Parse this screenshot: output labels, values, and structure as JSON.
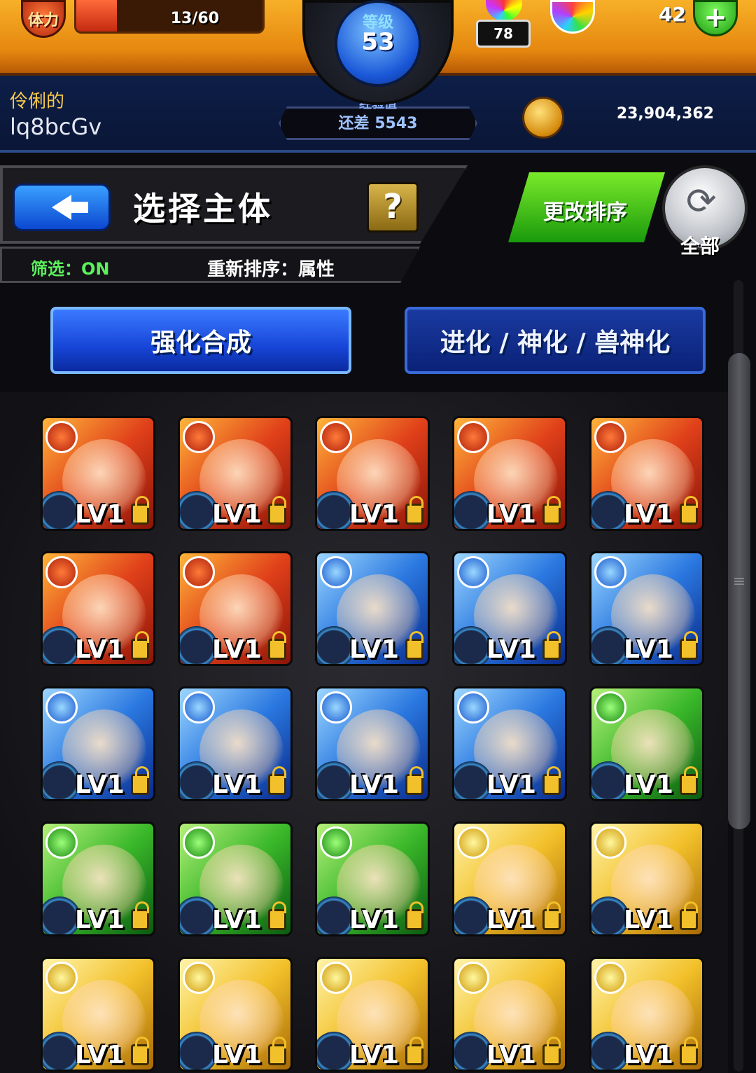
{
  "header": {
    "stamina_label": "体力",
    "stamina_text": "13/60",
    "stamina_fraction": 0.2167,
    "level_label": "等级",
    "level_value": "53",
    "exp_label": "经验值",
    "exp_remaining": "还差 5543",
    "crystal_count": "78",
    "orb_count": "42",
    "add_label": "+",
    "player_title": "伶俐的",
    "player_name": "lq8bcGv",
    "coin_count": "23,904,362"
  },
  "panel": {
    "title": "选择主体",
    "help_label": "?",
    "filter_label": "筛选：ON",
    "sort_label": "重新排序：属性",
    "sort_button_label": "更改排序",
    "all_label": "全部"
  },
  "tabs": [
    {
      "label": "强化合成",
      "active": true
    },
    {
      "label": "进化 / 神化 / 兽神化",
      "active": false
    }
  ],
  "colors": {
    "fire": "#e0401a",
    "water": "#2a78e0",
    "wood": "#3ab82a",
    "light": "#f2c02a"
  },
  "monsters": [
    {
      "attribute": "fire",
      "level": "LV1"
    },
    {
      "attribute": "fire",
      "level": "LV1"
    },
    {
      "attribute": "fire",
      "level": "LV1"
    },
    {
      "attribute": "fire",
      "level": "LV1"
    },
    {
      "attribute": "fire",
      "level": "LV1"
    },
    {
      "attribute": "fire",
      "level": "LV1"
    },
    {
      "attribute": "fire",
      "level": "LV1"
    },
    {
      "attribute": "water",
      "level": "LV1"
    },
    {
      "attribute": "water",
      "level": "LV1"
    },
    {
      "attribute": "water",
      "level": "LV1"
    },
    {
      "attribute": "water",
      "level": "LV1"
    },
    {
      "attribute": "water",
      "level": "LV1"
    },
    {
      "attribute": "water",
      "level": "LV1"
    },
    {
      "attribute": "water",
      "level": "LV1"
    },
    {
      "attribute": "wood",
      "level": "LV1"
    },
    {
      "attribute": "wood",
      "level": "LV1"
    },
    {
      "attribute": "wood",
      "level": "LV1"
    },
    {
      "attribute": "wood",
      "level": "LV1"
    },
    {
      "attribute": "light",
      "level": "LV1"
    },
    {
      "attribute": "light",
      "level": "LV1"
    },
    {
      "attribute": "light",
      "level": "LV1"
    },
    {
      "attribute": "light",
      "level": "LV1"
    },
    {
      "attribute": "light",
      "level": "LV1"
    },
    {
      "attribute": "light",
      "level": "LV1"
    },
    {
      "attribute": "light",
      "level": "LV1"
    }
  ]
}
